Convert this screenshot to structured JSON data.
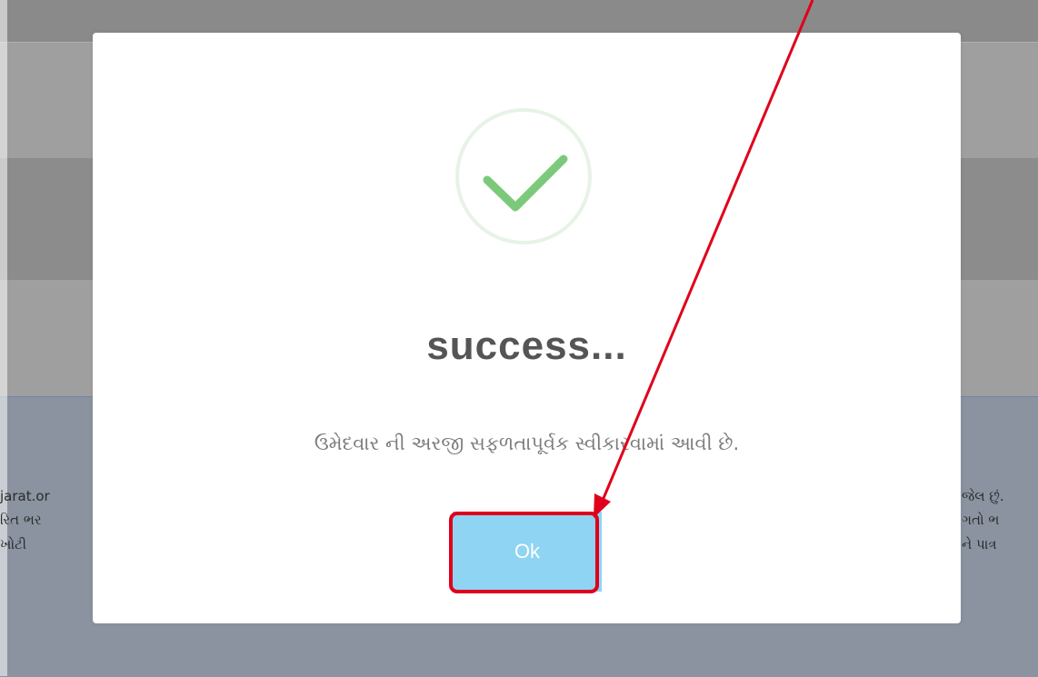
{
  "background": {
    "left_lines": [
      "jarat.or",
      "રિત ભર",
      "ખોટી"
    ],
    "right_lines": [
      "જેલ છું.",
      "ગતો ભ",
      "ને પાત્ર"
    ],
    "bottom_line": "... ... ... ... ... ... ... ..."
  },
  "modal": {
    "icon": "success-checkmark-icon",
    "title": "success...",
    "message": "ઉમેદવાર ની અરજી સફળતાપૂર્વક સ્વીકારવામાં આવી છે.",
    "ok_label": "Ok"
  },
  "annotation": {
    "arrow_color": "#e0001b",
    "highlight_color": "#e0001b"
  },
  "colors": {
    "check": "#7cc97c",
    "button": "#8fd4f2",
    "title": "#555555"
  }
}
